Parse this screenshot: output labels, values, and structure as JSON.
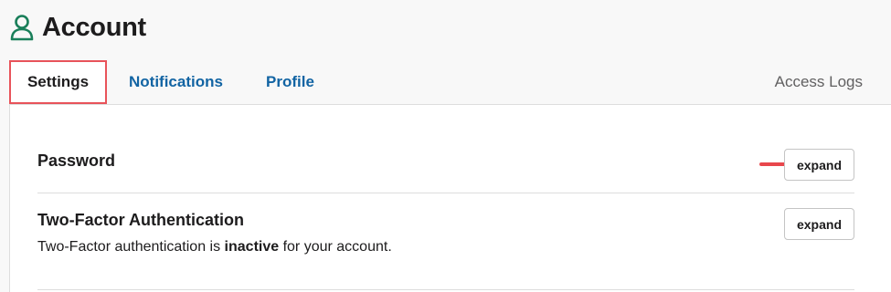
{
  "header": {
    "icon": "user-icon",
    "title": "Account"
  },
  "tabs": [
    {
      "label": "Settings",
      "active": true
    },
    {
      "label": "Notifications",
      "active": false
    },
    {
      "label": "Profile",
      "active": false
    },
    {
      "label": "Access Logs",
      "active": false
    }
  ],
  "settings": {
    "password": {
      "title": "Password",
      "button_label": "expand"
    },
    "two_factor": {
      "title": "Two-Factor Authentication",
      "desc_before": "Two-Factor authentication is ",
      "desc_status": "inactive",
      "desc_after": " for your account.",
      "button_label": "expand"
    }
  },
  "colors": {
    "accent_link": "#1264a3",
    "highlight_border": "#e8535a",
    "icon_green": "#1a7f5a",
    "arrow_red": "#e8474c"
  },
  "annotation": {
    "arrow_icon": "arrow-right-icon"
  }
}
